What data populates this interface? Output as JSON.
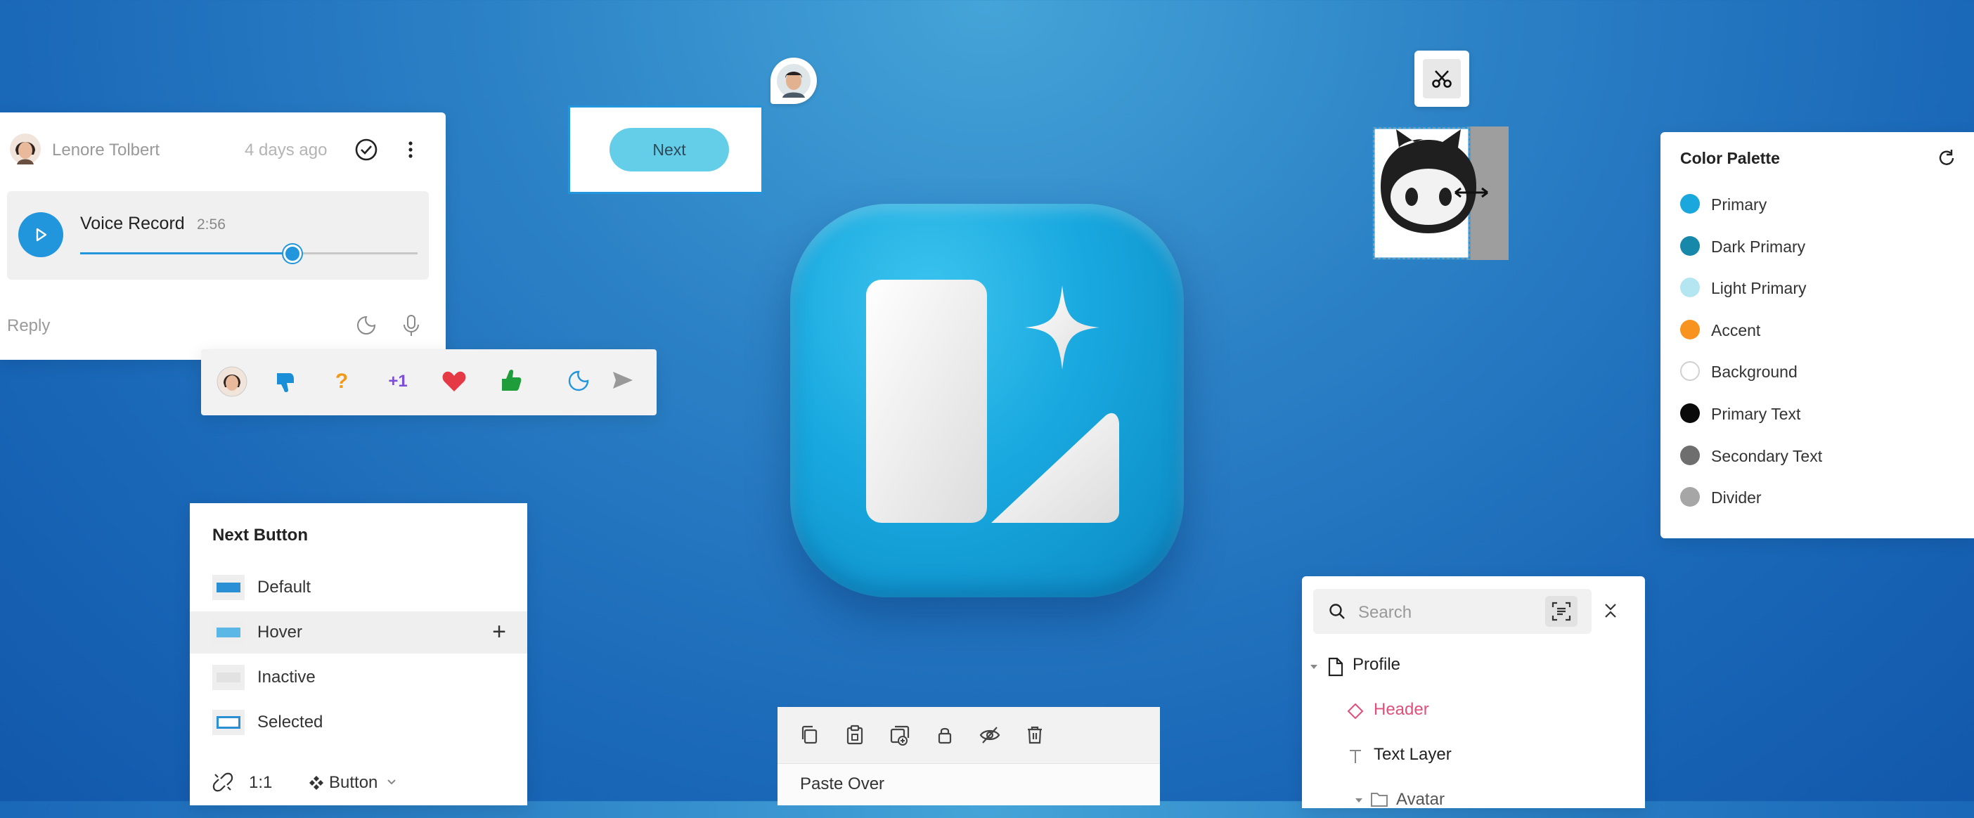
{
  "chat": {
    "user_name": "Lenore Tolbert",
    "time": "4 days ago",
    "voice_title": "Voice Record",
    "voice_duration": "2:56",
    "progress": 0.63,
    "reply_placeholder": "Reply"
  },
  "reactions": {
    "items": [
      "avatar",
      "thumbs-down",
      "question",
      "+1",
      "heart",
      "thumbs-up",
      "sticker",
      "send"
    ],
    "plus_one_label": "+1",
    "question_label": "?"
  },
  "next_button": {
    "label": "Next"
  },
  "palette": {
    "title": "Color Palette",
    "colors": [
      {
        "label": "Primary",
        "color": "#1aa7de"
      },
      {
        "label": "Dark Primary",
        "color": "#1888aa"
      },
      {
        "label": "Light Primary",
        "color": "#b4e6f2"
      },
      {
        "label": "Accent",
        "color": "#f7931e"
      },
      {
        "label": "Background",
        "color": "#ffffff"
      },
      {
        "label": "Primary Text",
        "color": "#0a0a0a"
      },
      {
        "label": "Secondary Text",
        "color": "#6e6e6e"
      },
      {
        "label": "Divider",
        "color": "#a6a6a6"
      }
    ]
  },
  "states": {
    "title": "Next Button",
    "rows": [
      {
        "label": "Default",
        "fill": "#2a8fd4"
      },
      {
        "label": "Hover",
        "fill": "#5bb8e6"
      },
      {
        "label": "Inactive",
        "fill": "#e6e6e6"
      },
      {
        "label": "Selected",
        "fill": "selected"
      }
    ],
    "ratio": "1:1",
    "component": "Button"
  },
  "toolbar": {
    "icons": [
      "copy-icon",
      "paste-icon",
      "duplicate-icon",
      "lock-icon",
      "hide-icon",
      "delete-icon"
    ],
    "paste_label": "Paste Over"
  },
  "layers": {
    "search_placeholder": "Search",
    "items": [
      "Profile",
      "Header",
      "Text Layer",
      "Avatar"
    ]
  }
}
